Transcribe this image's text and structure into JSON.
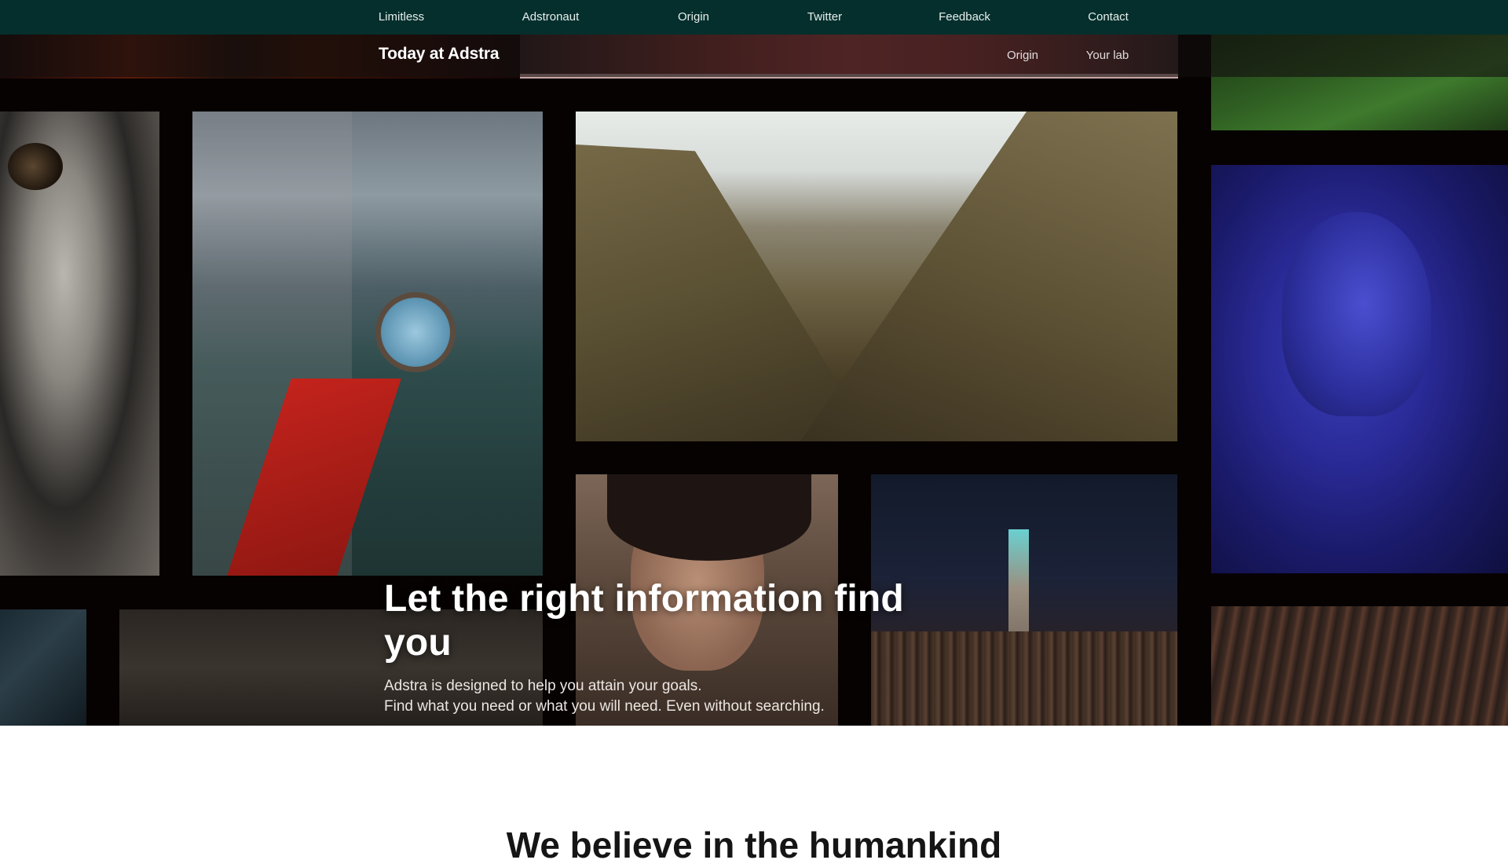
{
  "nav": {
    "items": [
      {
        "label": "Limitless"
      },
      {
        "label": "Adstronaut"
      },
      {
        "label": "Origin"
      },
      {
        "label": "Twitter"
      },
      {
        "label": "Feedback"
      },
      {
        "label": "Contact"
      }
    ]
  },
  "subnav": {
    "brand": "Today at Adstra",
    "links": [
      {
        "label": "Origin"
      },
      {
        "label": "Your lab"
      }
    ]
  },
  "hero": {
    "title": "Let the right information find you",
    "line1": "Adstra is designed to help you attain your goals.",
    "line2": "Find what you need or what you will need. Even without searching."
  },
  "gallery": {
    "images": [
      {
        "subject": "astronaut-on-moon"
      },
      {
        "subject": "hand-holding-compass"
      },
      {
        "subject": "mountain-canyon"
      },
      {
        "subject": "smiling-woman-freckles"
      },
      {
        "subject": "city-lightning-night"
      },
      {
        "subject": "woman-glitter-blue-light"
      },
      {
        "subject": "hikers-green-forest"
      },
      {
        "subject": "architecture-lines"
      },
      {
        "subject": "building-facade"
      },
      {
        "subject": "red-sunset-figure"
      }
    ]
  },
  "section": {
    "title": "We believe in the humankind"
  },
  "colors": {
    "nav_bg": "#052f2c",
    "hero_bg": "#070202",
    "page_bg": "#ffffff"
  }
}
